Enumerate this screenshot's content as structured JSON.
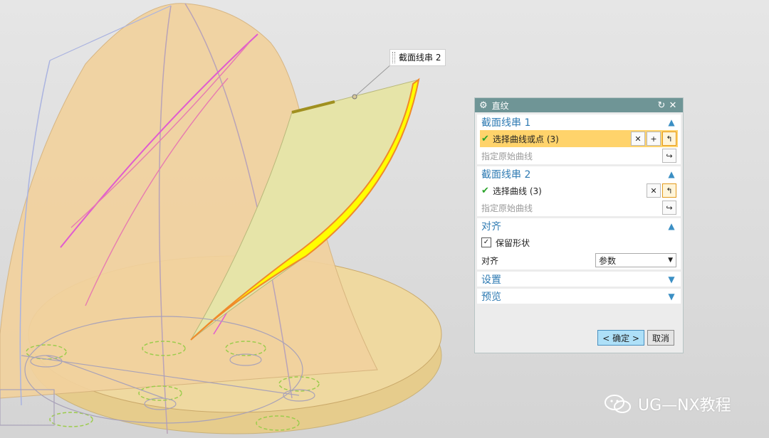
{
  "viewport": {
    "callout_label": "截面线串 2"
  },
  "dialog": {
    "title": "直纹",
    "section1": {
      "title": "截面线串 1",
      "select_label": "选择曲线或点 (3)",
      "specify_label": "指定原始曲线"
    },
    "section2": {
      "title": "截面线串 2",
      "select_label": "选择曲线 (3)",
      "specify_label": "指定原始曲线"
    },
    "align": {
      "title": "对齐",
      "keep_shape_label": "保留形状",
      "keep_shape_checked": true,
      "align_label": "对齐",
      "align_value": "参数"
    },
    "settings": {
      "title": "设置"
    },
    "preview": {
      "title": "预览"
    },
    "ok_label": "< 确定 >",
    "cancel_label": "取消"
  },
  "watermark": {
    "text": "UG—NX教程"
  },
  "colors": {
    "titlebar": "#6f9596",
    "accent": "#2f7bb3",
    "selection": "#ffd36b"
  }
}
